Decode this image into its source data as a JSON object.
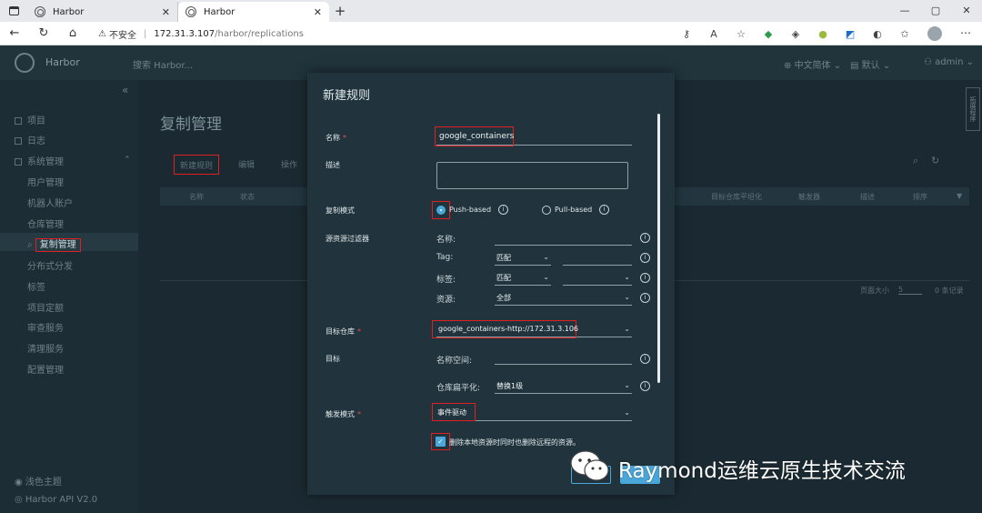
{
  "browser": {
    "tabs": [
      {
        "title": "Harbor"
      },
      {
        "title": "Harbor"
      }
    ],
    "new_tab": "+",
    "insecure_label": "不安全",
    "url_host": "172.31.3.107",
    "url_path": "/harbor/replications",
    "win_min": "—",
    "win_max": "▢",
    "win_close": "✕"
  },
  "app": {
    "brand": "Harbor",
    "search_placeholder": "搜索 Harbor...",
    "language": "中文简体",
    "default_label": "默认",
    "user": "admin",
    "side_panel_text": "拓展程序"
  },
  "sidebar": {
    "items": [
      {
        "label": "项目"
      },
      {
        "label": "日志"
      },
      {
        "label": "系统管理"
      },
      {
        "label": "用户管理"
      },
      {
        "label": "机器人账户"
      },
      {
        "label": "仓库管理"
      },
      {
        "label": "复制管理"
      },
      {
        "label": "分布式分发"
      },
      {
        "label": "标签"
      },
      {
        "label": "项目定额"
      },
      {
        "label": "审查服务"
      },
      {
        "label": "清理服务"
      },
      {
        "label": "配置管理"
      }
    ],
    "footer": [
      {
        "label": "浅色主题"
      },
      {
        "label": "Harbor API V2.0"
      }
    ]
  },
  "main": {
    "title": "复制管理",
    "new_rule_button": "新建规则",
    "edit_button": "编辑",
    "other_button": "操作",
    "columns": [
      "名称",
      "状态",
      "目标仓库平坦化",
      "触发器",
      "描述",
      "排序"
    ],
    "page_size_label": "页面大小",
    "page_size_value": "5",
    "count_label": "0 条记录"
  },
  "modal": {
    "title": "新建规则",
    "name_label": "名称",
    "name_value": "google_containers",
    "desc_label": "描述",
    "mode_label": "复制模式",
    "push_label": "Push-based",
    "pull_label": "Pull-based",
    "filter_label": "源资源过滤器",
    "filter_name_label": "名称:",
    "filter_tag_label": "Tag:",
    "filter_tag_value": "匹配",
    "filter_label_label": "标签:",
    "filter_label_value": "匹配",
    "filter_res_label": "资源:",
    "filter_res_value": "全部",
    "target_repo_label": "目标仓库",
    "target_repo_value": "google_containers-http://172.31.3.106",
    "target_label": "目标",
    "namespace_label": "名称空间:",
    "flatten_label": "仓库扁平化:",
    "flatten_value": "替换1级",
    "trigger_label": "触发模式",
    "trigger_value": "事件驱动",
    "delete_checkbox_label": "删除本地资源时同时也删除远程的资源。",
    "required_mark": "*"
  },
  "watermark": {
    "text": "Raymond运维云原生技术交流"
  }
}
